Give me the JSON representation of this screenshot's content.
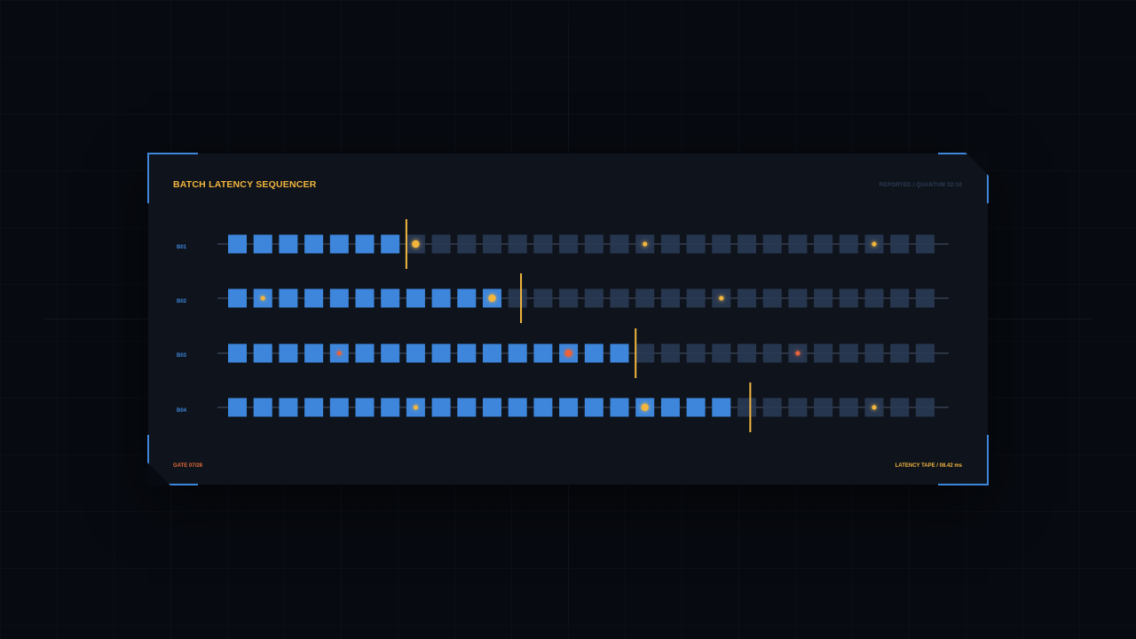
{
  "panel": {
    "title": "BATCH LATENCY SEQUENCER",
    "subtitle": "REPORTED / QUANTUM 32:10",
    "footer_left": "GATE 07/28",
    "footer_right": "LATENCY TAPE / 08.42 ms"
  },
  "colors": {
    "accent": "#3d86dc",
    "inactive": "#2a3a55",
    "marker": "#f2b63e",
    "alert": "#e8633e",
    "track": "#2b3442"
  },
  "sequencer": {
    "steps": 28,
    "lanes": [
      {
        "label": "B01",
        "progress": 7,
        "dots": [
          {
            "step": 7,
            "color": "marker",
            "size": "lg"
          },
          {
            "step": 16,
            "color": "marker",
            "size": "sm"
          },
          {
            "step": 25,
            "color": "marker",
            "size": "sm"
          }
        ]
      },
      {
        "label": "B02",
        "progress": 11.5,
        "dots": [
          {
            "step": 1,
            "color": "marker",
            "size": "sm"
          },
          {
            "step": 10,
            "color": "marker",
            "size": "lg"
          },
          {
            "step": 19,
            "color": "marker",
            "size": "sm"
          }
        ]
      },
      {
        "label": "B03",
        "progress": 16,
        "dots": [
          {
            "step": 4,
            "color": "alert",
            "size": "sm"
          },
          {
            "step": 13,
            "color": "alert",
            "size": "lg"
          },
          {
            "step": 22,
            "color": "alert",
            "size": "sm"
          }
        ]
      },
      {
        "label": "B04",
        "progress": 20.5,
        "dots": [
          {
            "step": 7,
            "color": "marker",
            "size": "sm"
          },
          {
            "step": 16,
            "color": "marker",
            "size": "lg"
          },
          {
            "step": 25,
            "color": "marker",
            "size": "sm"
          }
        ]
      }
    ]
  }
}
